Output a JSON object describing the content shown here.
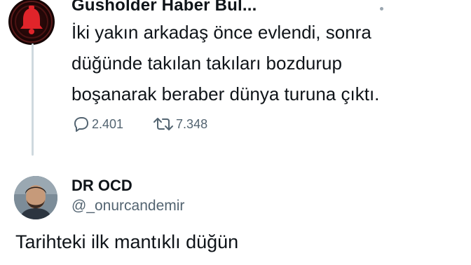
{
  "parent_tweet": {
    "display_name": "Gusholder Haber Bul...",
    "text_lines": [
      "İki yakın arkadaş önce evlendi, sonra",
      "düğünde takılan takıları bozdurup",
      "boşanarak beraber dünya turuna çıktı."
    ],
    "reply_count": "2.401",
    "retweet_count": "7.348",
    "avatar_icon": "bell-icon",
    "avatar_color": "#e0242a"
  },
  "reply_tweet": {
    "display_name": "DR OCD",
    "handle": "@_onurcandemir",
    "text": "Tarihteki ilk mantıklı düğün"
  },
  "colors": {
    "text_primary": "#0f1419",
    "text_secondary": "#536471",
    "thread_line": "#cfd9de"
  }
}
